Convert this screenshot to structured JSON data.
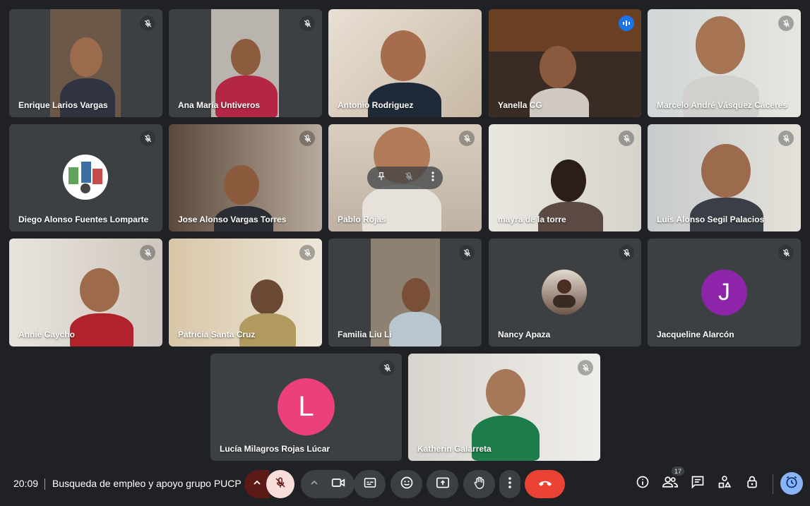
{
  "meeting": {
    "time": "20:09",
    "title": "Busqueda de empleo y apoyo grupo PUCP",
    "participant_count": "17"
  },
  "participants": [
    {
      "name": "Enrique Larios Vargas",
      "muted": true
    },
    {
      "name": "Ana María Untiveros",
      "muted": true
    },
    {
      "name": "Antonio Rodriguez",
      "muted": false
    },
    {
      "name": "Yanella CG",
      "speaking": true
    },
    {
      "name": "Marcelo André Vásquez Cáceres",
      "muted": true
    },
    {
      "name": "Diego Alonso Fuentes Lomparte",
      "muted": true
    },
    {
      "name": "Jose Alonso Vargas Torres",
      "muted": true
    },
    {
      "name": "Pablo Rojas",
      "muted": true
    },
    {
      "name": "mayra de la torre",
      "muted": true
    },
    {
      "name": "Luis Alonso Segil Palacios",
      "muted": true
    },
    {
      "name": "Annie Caycho",
      "muted": true
    },
    {
      "name": "Patricia Santa Cruz",
      "muted": true
    },
    {
      "name": "Familia Liu Li",
      "muted": true
    },
    {
      "name": "Nancy Apaza",
      "muted": true
    },
    {
      "name": "Jacqueline Alarcón",
      "muted": true,
      "initial": "J",
      "color": "#8e24aa"
    },
    {
      "name": "Lucía Milagros Rojas Lúcar",
      "muted": true,
      "initial": "L",
      "color": "#ec407a"
    },
    {
      "name": "Katherin Galarreta",
      "muted": true
    }
  ],
  "colors": {
    "background": "#202124",
    "tile": "#3c4043",
    "control": "#3c4043",
    "end_call": "#ea4335",
    "mic_off_active": "#f9dedc",
    "speaking_outline": "#8ab4f8"
  },
  "controls": {
    "icons": [
      "chevron-up-icon",
      "mic-off-icon",
      "camera-icon",
      "captions-icon",
      "emoji-icon",
      "present-icon",
      "raise-hand-icon",
      "more-options-icon",
      "end-call-icon"
    ],
    "right_icons": [
      "info-icon",
      "people-icon",
      "chat-icon",
      "activities-icon",
      "host-controls-icon",
      "timer-icon"
    ]
  }
}
